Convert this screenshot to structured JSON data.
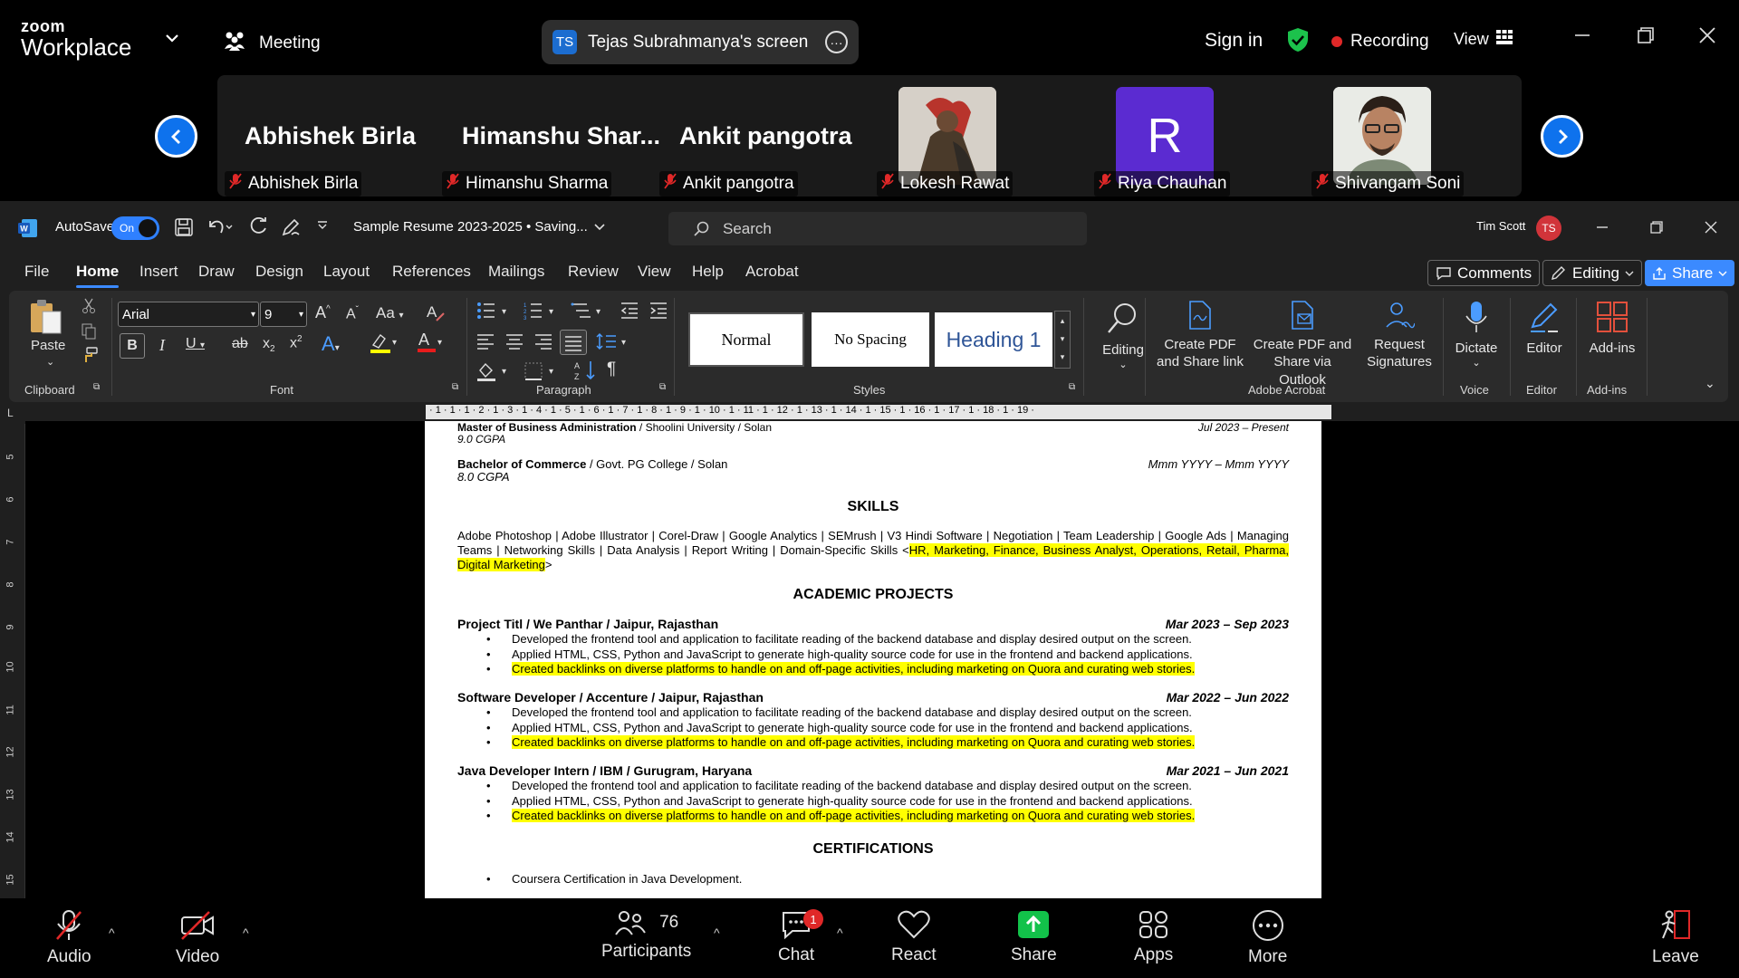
{
  "zoom": {
    "logo_line1": "zoom",
    "logo_line2": "Workplace",
    "meeting_label": "Meeting",
    "screen_badge": "TS",
    "screen_share_label": "Tejas Subrahmanya's screen",
    "sign_in": "Sign in",
    "recording": "Recording",
    "view": "View",
    "participants": [
      {
        "big": "Abhishek Birla",
        "name": "Abhishek Birla"
      },
      {
        "big": "Himanshu  Shar...",
        "name": "Himanshu Sharma"
      },
      {
        "big": "Ankit pangotra",
        "name": "Ankit pangotra"
      },
      {
        "big": "",
        "name": "Lokesh Rawat"
      },
      {
        "big": "R",
        "name": "Riya Chauhan"
      },
      {
        "big": "",
        "name": "Shivangam Soni"
      }
    ],
    "bottom": {
      "audio": "Audio",
      "video": "Video",
      "participants": "Participants",
      "participant_count": "76",
      "chat": "Chat",
      "chat_badge": "1",
      "react": "React",
      "share": "Share",
      "apps": "Apps",
      "more": "More",
      "leave": "Leave"
    },
    "colors": {
      "accent": "#0e72ed",
      "share_green": "#12c24a",
      "recording_red": "#e02828",
      "avatar_purple": "#5b2bd1"
    }
  },
  "word": {
    "autosave_label": "AutoSave",
    "autosave_state": "On",
    "doc_title": "Sample Resume 2023-2025 • Saving...",
    "search_placeholder": "Search",
    "user_name": "Tim Scott",
    "user_initials": "TS",
    "menu": [
      "File",
      "Home",
      "Insert",
      "Draw",
      "Design",
      "Layout",
      "References",
      "Mailings",
      "Review",
      "View",
      "Help",
      "Acrobat"
    ],
    "comments_btn": "Comments",
    "editing_btn": "Editing",
    "share_btn": "Share",
    "ribbon": {
      "paste": "Paste",
      "clipboard": "Clipboard",
      "font_name": "Arial",
      "font_size": "9",
      "font_group": "Font",
      "paragraph_group": "Paragraph",
      "styles": [
        "Normal",
        "No Spacing",
        "Heading 1"
      ],
      "styles_group": "Styles",
      "editing": "Editing",
      "create_pdf_link": "Create PDF and Share link",
      "create_pdf_outlook": "Create PDF and Share via Outlook",
      "request_signatures": "Request Signatures",
      "adobe_group": "Adobe Acrobat",
      "dictate": "Dictate",
      "voice_group": "Voice",
      "editor": "Editor",
      "editor_group": "Editor",
      "addins": "Add-ins",
      "addins_group": "Add-ins"
    },
    "ruler_h": "· 1 · 1 · 1 · 2 · 1 · 3 · 1 · 4 · 1 · 5 · 1 · 6 · 1 · 7 · 1 · 8 · 1 · 9 · 1 · 10 · 1 · 11 · 1 · 12 · 1 · 13 · 1 · 14 · 1 · 15 · 1 · 16 · 1 · 17 · 1 · 18 · 1 · 19 ·",
    "ruler_v": [
      "5",
      "6",
      "7",
      "8",
      "9",
      "10",
      "11",
      "12",
      "13",
      "14",
      "15"
    ],
    "document": {
      "mba_title": "Master of Business Administration",
      "mba_rest": " / Shoolini University / Solan",
      "mba_date": "Jul 2023 – Present",
      "mba_cgpa": "9.0 CGPA",
      "bcom_title": "Bachelor of Commerce",
      "bcom_rest": " / Govt. PG College / Solan",
      "bcom_date": "Mmm YYYY – Mmm YYYY",
      "bcom_cgpa": "8.0 CGPA",
      "skills_heading": "SKILLS",
      "skills_text": "Adobe Photoshop | Adobe Illustrator | Corel-Draw | Google Analytics | SEMrush | V3 Hindi Software | Negotiation | Team Leadership | Google Ads | Managing Teams | Networking Skills | Data Analysis | Report Writing | Domain-Specific Skills <",
      "skills_highlight": "HR, Marketing, Finance, Business Analyst, Operations, Retail, Pharma, Digital Marketing",
      "skills_end": ">",
      "projects_heading": "ACADEMIC PROJECTS",
      "jobs": [
        {
          "title": "Project Titl / We Panthar / Jaipur, Rajasthan",
          "date": "Mar 2023 – Sep 2023",
          "bullets": [
            "Developed the frontend tool and application to facilitate reading of the backend database and display desired output on the screen.",
            "Applied HTML, CSS, Python and JavaScript to generate high-quality source code for use in the frontend and backend applications."
          ],
          "highlight_bullet": "Created backlinks on diverse platforms to handle on and off-page activities, including marketing on Quora and curating web stories."
        },
        {
          "title": "Software Developer / Accenture / Jaipur, Rajasthan",
          "date": "Mar 2022 – Jun 2022",
          "bullets": [
            "Developed the frontend tool and application to facilitate reading of the backend database and display desired output on the screen.",
            "Applied HTML, CSS, Python and JavaScript to generate high-quality source code for use in the frontend and backend applications."
          ],
          "highlight_bullet": "Created backlinks on diverse platforms to handle on and off-page activities, including marketing on Quora and curating web stories."
        },
        {
          "title": "Java Developer Intern / IBM / Gurugram, Haryana",
          "date": "Mar 2021 – Jun 2021",
          "bullets": [
            "Developed the frontend tool and application to facilitate reading of the backend database and display desired output on the screen.",
            "Applied HTML, CSS, Python and JavaScript to generate high-quality source code for use in the frontend and backend applications."
          ],
          "highlight_bullet": "Created backlinks on diverse platforms to handle on and off-page activities, including marketing on Quora and curating web stories."
        }
      ],
      "cert_heading": "CERTIFICATIONS",
      "cert_item": "Coursera Certification in Java Development."
    }
  }
}
